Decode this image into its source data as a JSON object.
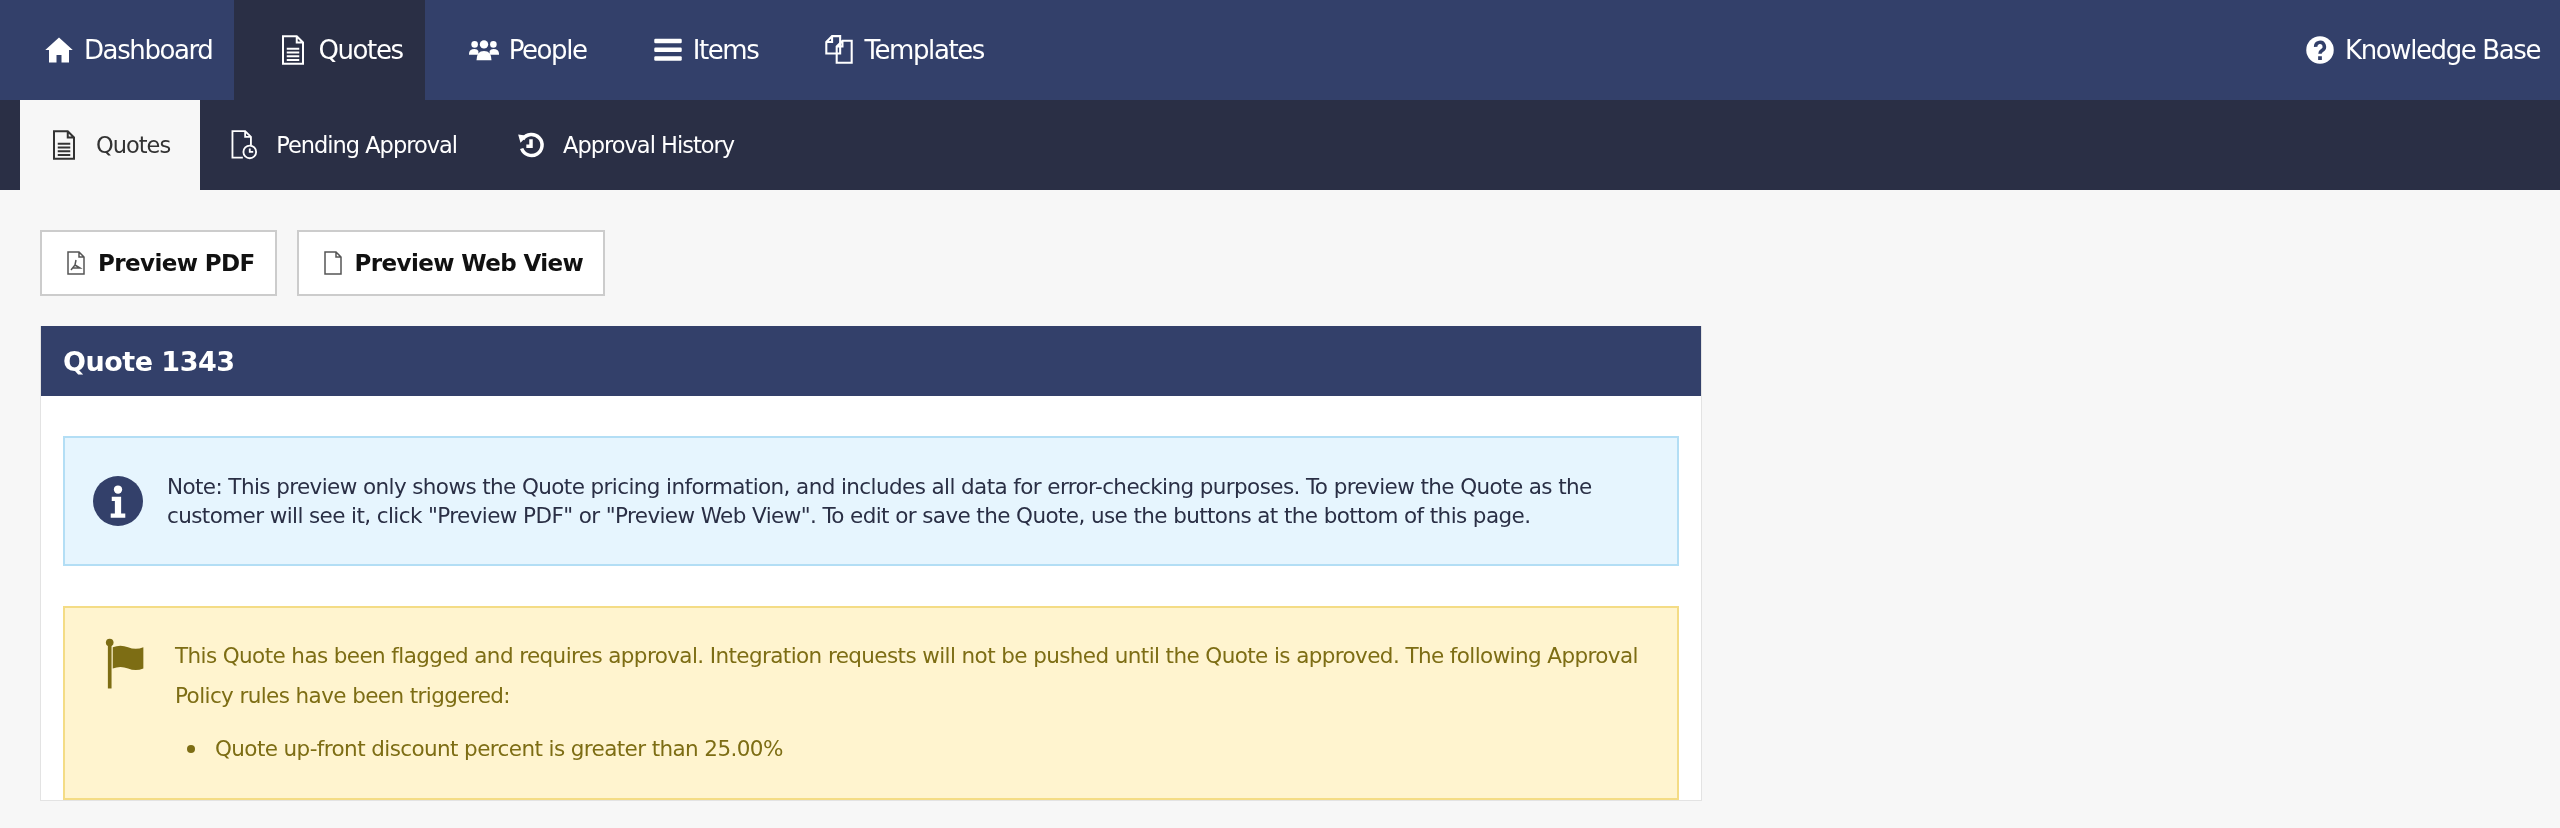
{
  "top_nav": {
    "items": [
      {
        "label": "Dashboard",
        "selected": false
      },
      {
        "label": "Quotes",
        "selected": true
      },
      {
        "label": "People",
        "selected": false
      },
      {
        "label": "Items",
        "selected": false
      },
      {
        "label": "Templates",
        "selected": false
      }
    ],
    "right_link": {
      "label": "Knowledge Base"
    }
  },
  "sub_nav": {
    "items": [
      {
        "label": "Quotes",
        "selected": true
      },
      {
        "label": "Pending Approval",
        "selected": false
      },
      {
        "label": "Approval History",
        "selected": false
      }
    ]
  },
  "toolbar": {
    "buttons": [
      {
        "label": "Preview PDF"
      },
      {
        "label": "Preview Web View"
      }
    ]
  },
  "panel": {
    "title": "Quote 1343",
    "info_note": "Note: This preview only shows the Quote pricing information, and includes all data for error-checking purposes. To preview the Quote as the customer will see it, click \"Preview PDF\" or \"Preview Web View\". To edit or save the Quote, use the buttons at the bottom of this page.",
    "warning": {
      "message": "This Quote has been flagged and requires approval. Integration requests will not be pushed until the Quote is approved. The following Approval Policy rules have been triggered:",
      "rules": [
        "Quote up-front discount percent is greater than 25.00%"
      ]
    }
  }
}
